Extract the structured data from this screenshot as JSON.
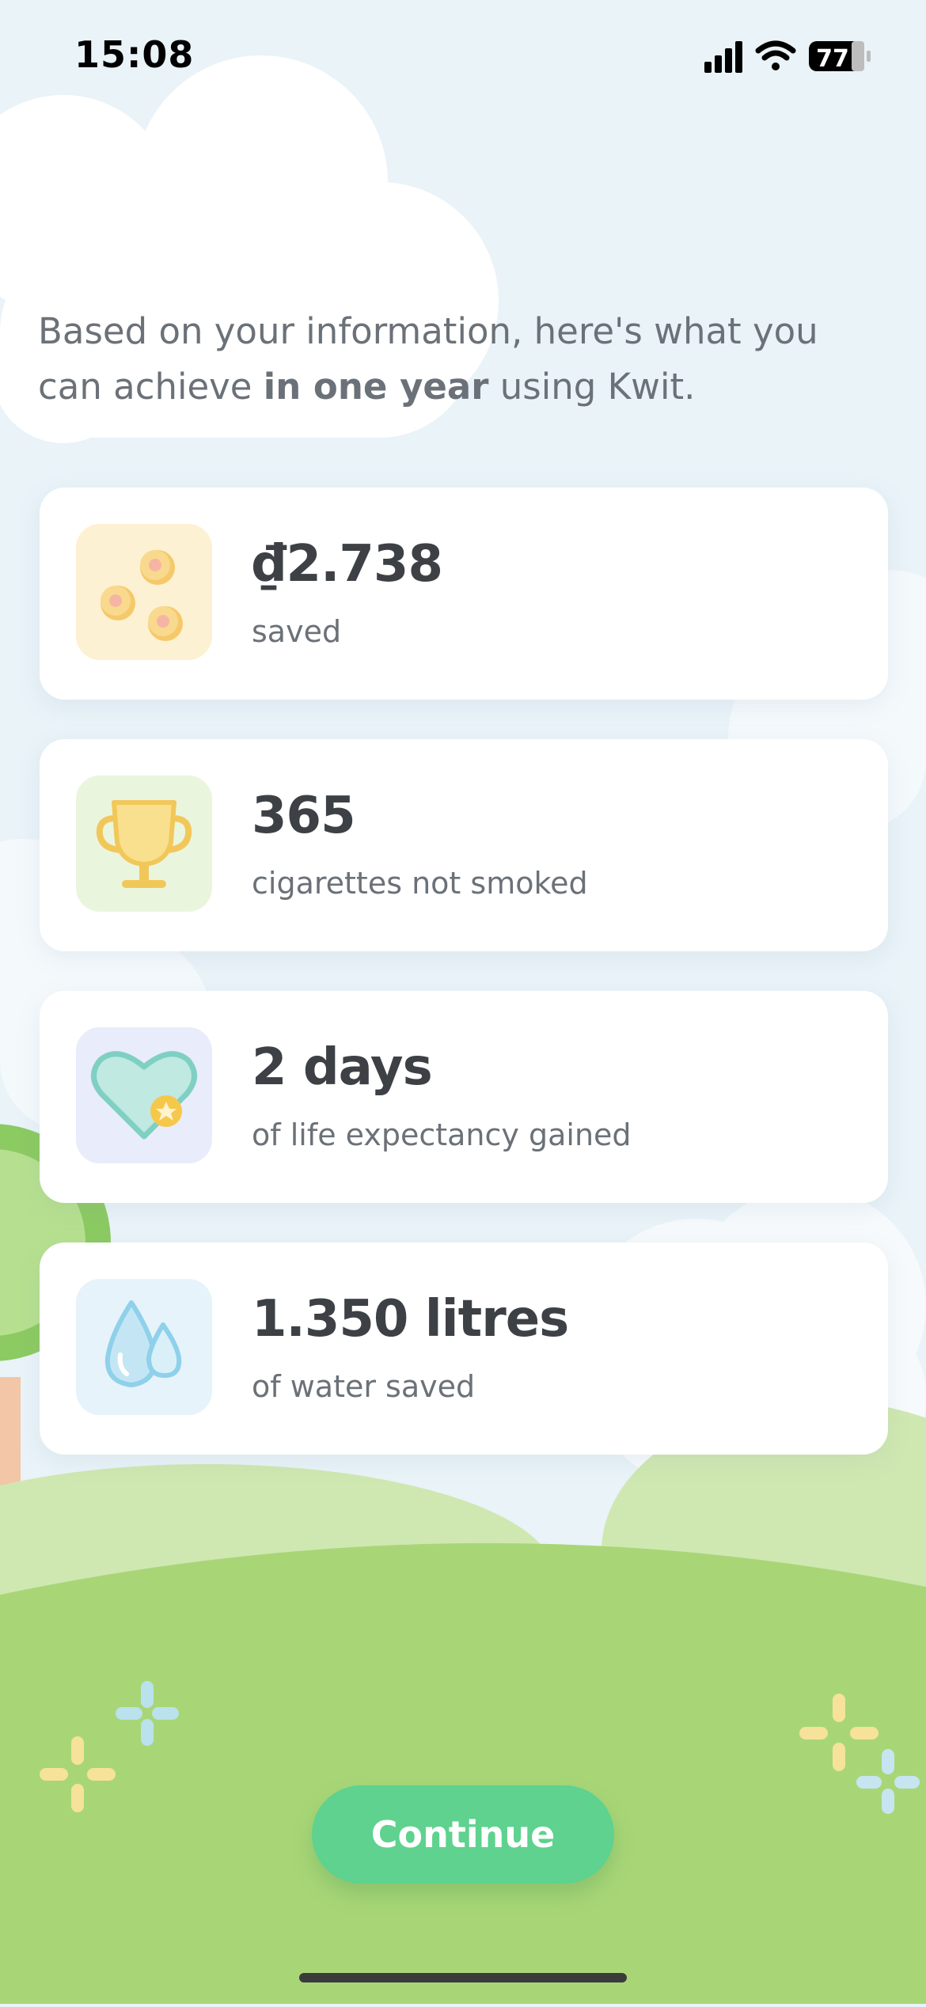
{
  "status_bar": {
    "time": "15:08",
    "battery": "77"
  },
  "intro": {
    "text_before": "Based on your information, here's what you can achieve ",
    "text_bold": "in one year",
    "text_after": " using Kwit."
  },
  "stats": [
    {
      "value": "₫2.738",
      "label": "saved",
      "icon": "coins-icon",
      "icon_bg": "#fdf1d3"
    },
    {
      "value": "365",
      "label": "cigarettes not smoked",
      "icon": "trophy-icon",
      "icon_bg": "#eaf5de"
    },
    {
      "value": "2 days",
      "label": "of life expectancy gained",
      "icon": "heart-icon",
      "icon_bg": "#e9ecfa"
    },
    {
      "value": "1.350 litres",
      "label": "of water saved",
      "icon": "water-drops-icon",
      "icon_bg": "#e6f3fa"
    }
  ],
  "continue_button": {
    "label": "Continue"
  },
  "colors": {
    "button": "#5ed28e",
    "grass": "#a8d677",
    "sky": "#e9f3f8"
  }
}
